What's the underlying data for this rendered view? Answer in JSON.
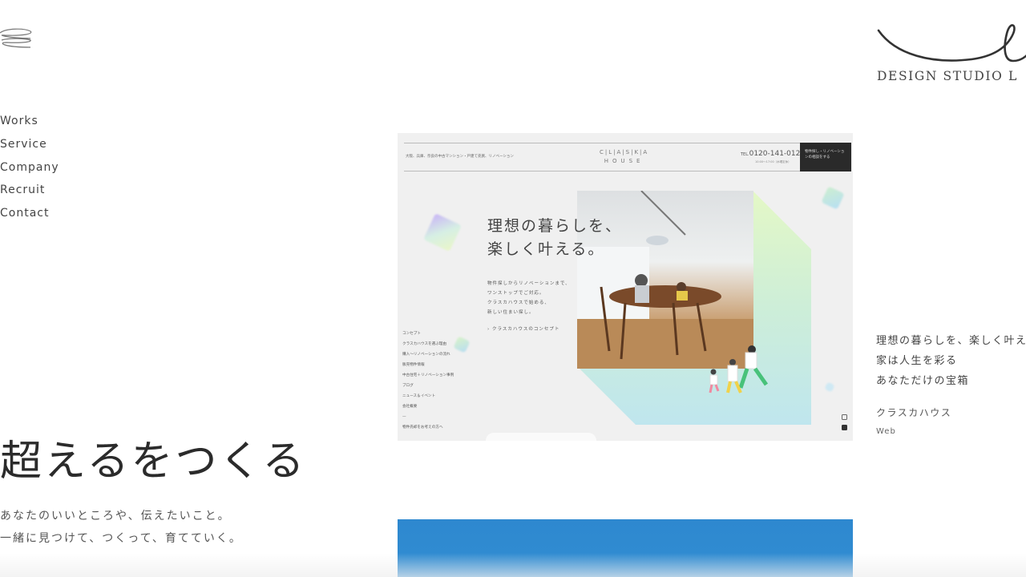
{
  "header": {
    "menu_icon": "hamburger-loop-icon",
    "logo": {
      "mark": "script-l-icon",
      "text": "DESIGN STUDIO L"
    }
  },
  "nav": {
    "items": [
      {
        "label": "Works"
      },
      {
        "label": "Service"
      },
      {
        "label": "Company"
      },
      {
        "label": "Recruit"
      },
      {
        "label": "Contact"
      }
    ]
  },
  "hero": {
    "title": "超えるをつくる",
    "subtitle_lines": [
      "あなたのいいところや、伝えたいこと。",
      "一緒に見つけて、つくって、育てていく。"
    ]
  },
  "work": {
    "preview": {
      "tagline": "大阪、兵庫、奈良の中古マンション・戸建て売買、リノベーション",
      "logo_top": "C|L|A|S|K|A",
      "logo_bottom": "HOUSE",
      "tel_prefix": "TEL.",
      "tel": "0120-141-012",
      "hours": "10:00〜17:00（水曜定休）",
      "cta": "物件探し・リノベーションの相談をする",
      "title_lines": [
        "理想の暮らしを、",
        "楽しく叶える。"
      ],
      "body_lines": [
        "物件探しからリノベーションまで、",
        "ワンストップでご対応。",
        "クラスカハウスで始める、",
        "新しい住まい探し。"
      ],
      "concept_link": "› クラスカハウスのコンセプト",
      "menu": [
        "コンセプト",
        "クラスカハウスを選ぶ理由",
        "購入〜リノベーションの流れ",
        "販売物件情報",
        "中古住宅＋リノベーション事例",
        "ブログ",
        "ニュース＆イベント",
        "会社概要",
        "—",
        "物件売却をお考えの方へ"
      ],
      "social_icons": [
        "instagram-icon",
        "facebook-icon"
      ]
    },
    "description_lines": [
      "理想の暮らしを、楽しく叶える",
      "家は人生を彩る",
      "あなただけの宝箱"
    ],
    "client": "クラスカハウス",
    "category": "Web",
    "next_work_color": "#2e88cf"
  }
}
